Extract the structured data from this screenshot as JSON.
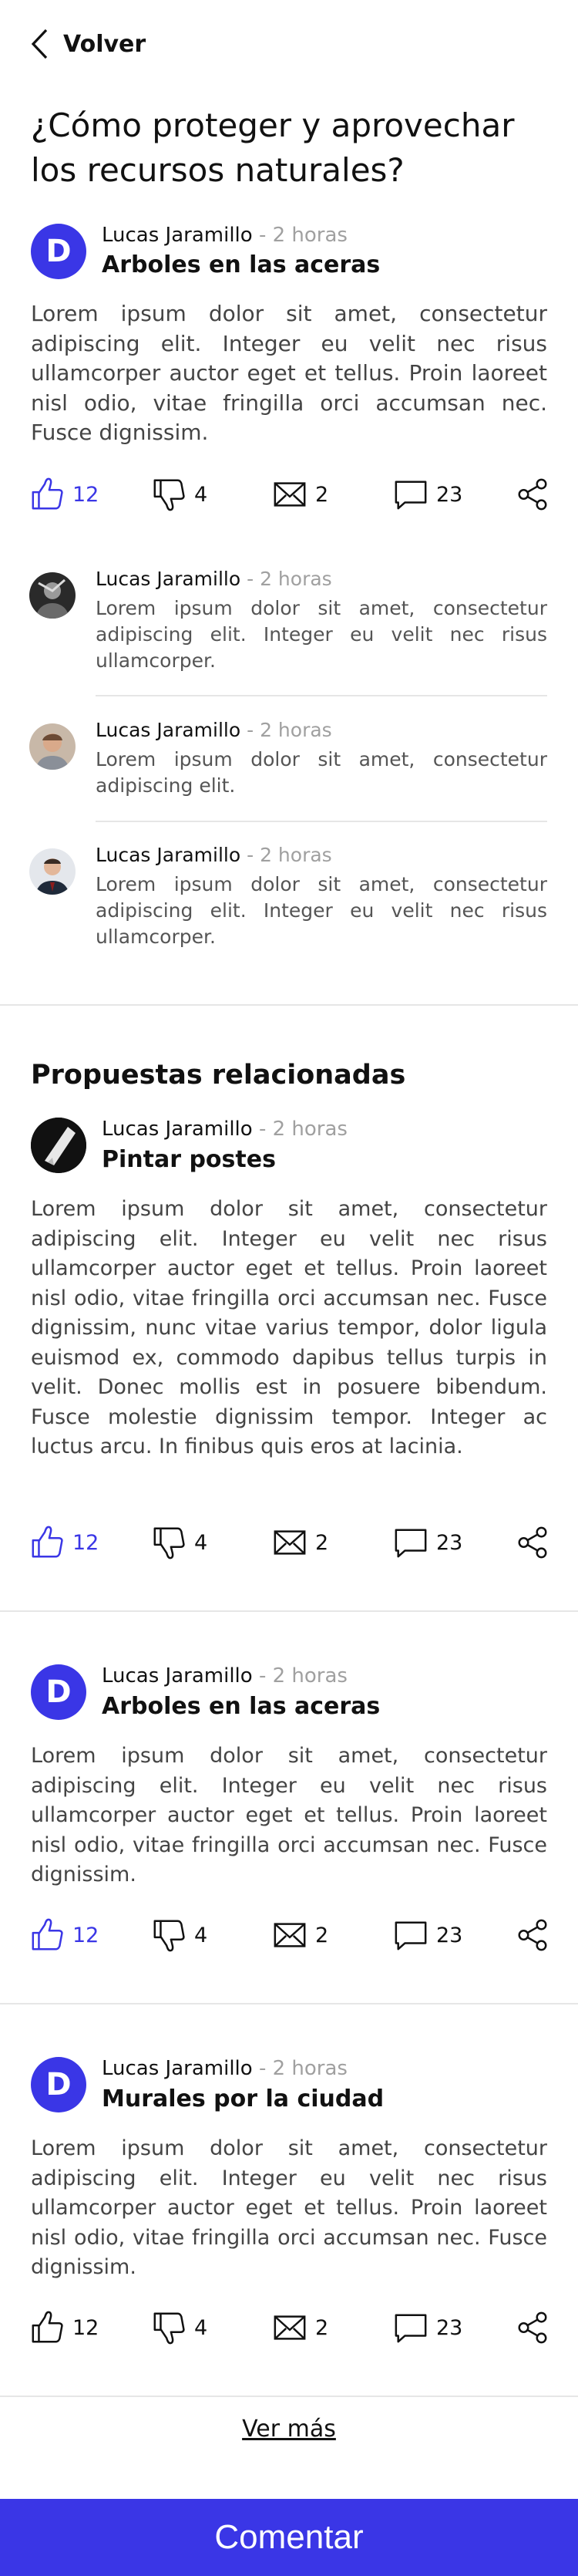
{
  "nav": {
    "back_label": "Volver"
  },
  "page": {
    "title": "¿Cómo proteger y aprovechar los recursos naturales?"
  },
  "main_post": {
    "author": "Lucas Jaramillo",
    "time": " - 2 horas",
    "avatar_letter": "D",
    "title": "Arboles en las aceras",
    "body": "Lorem ipsum dolor sit amet, consectetur adipiscing elit. Integer eu velit nec risus ullamcorper auctor eget et tellus. Proin laoreet nisl odio, vitae fringilla orci accumsan nec. Fusce dignissim.",
    "likes": "12",
    "dislikes": "4",
    "messages": "2",
    "comments": "23"
  },
  "comments": [
    {
      "author": "Lucas Jaramillo",
      "time": " - 2 horas",
      "text": "Lorem ipsum dolor sit amet, consectetur adipiscing elit. Integer eu velit nec risus ullamcorper."
    },
    {
      "author": "Lucas Jaramillo",
      "time": " - 2 horas",
      "text": "Lorem ipsum dolor sit amet, consectetur adipiscing elit."
    },
    {
      "author": "Lucas Jaramillo",
      "time": " - 2 horas",
      "text": "Lorem ipsum dolor sit amet, consectetur adipiscing elit. Integer eu velit nec risus ullamcorper."
    }
  ],
  "related": {
    "heading": "Propuestas relacionadas",
    "items": [
      {
        "author": "Lucas Jaramillo",
        "time": " - 2 horas",
        "title": "Pintar postes",
        "body": "Lorem ipsum dolor sit amet, consectetur adipiscing elit. Integer eu velit nec risus ullamcorper auctor eget et tellus. Proin laoreet nisl odio, vitae fringilla orci accumsan nec. Fusce dignissim, nunc vitae varius tempor, dolor ligula euismod ex, commodo dapibus tellus turpis in velit. Donec mollis est in posuere bibendum. Fusce molestie dignissim tempor. Integer ac luctus arcu. In finibus quis eros at lacinia.",
        "likes": "12",
        "dislikes": "4",
        "messages": "2",
        "comments": "23"
      },
      {
        "author": "Lucas Jaramillo",
        "time": " - 2 horas",
        "avatar_letter": "D",
        "title": "Arboles en las aceras",
        "body": "Lorem ipsum dolor sit amet, consectetur adipiscing elit. Integer eu velit nec risus ullamcorper auctor eget et tellus. Proin laoreet nisl odio, vitae fringilla orci accumsan nec. Fusce dignissim.",
        "likes": "12",
        "dislikes": "4",
        "messages": "2",
        "comments": "23"
      },
      {
        "author": "Lucas Jaramillo",
        "time": " - 2 horas",
        "avatar_letter": "D",
        "title": "Murales por la ciudad",
        "body": "Lorem ipsum dolor sit amet, consectetur adipiscing elit. Integer eu velit nec risus ullamcorper auctor eget et tellus. Proin laoreet nisl odio, vitae fringilla orci accumsan nec. Fusce dignissim.",
        "likes": "12",
        "dislikes": "4",
        "messages": "2",
        "comments": "23"
      }
    ]
  },
  "footer": {
    "see_more": "Ver más",
    "comment_button": "Comentar"
  },
  "colors": {
    "accent": "#3a36e6",
    "muted": "#a0a0a0",
    "text": "#111111",
    "divider": "#e6e6e6"
  },
  "icons": [
    "chevron-left-icon",
    "thumbs-up-icon",
    "thumbs-down-icon",
    "envelope-icon",
    "comment-bubble-icon",
    "share-icon"
  ]
}
